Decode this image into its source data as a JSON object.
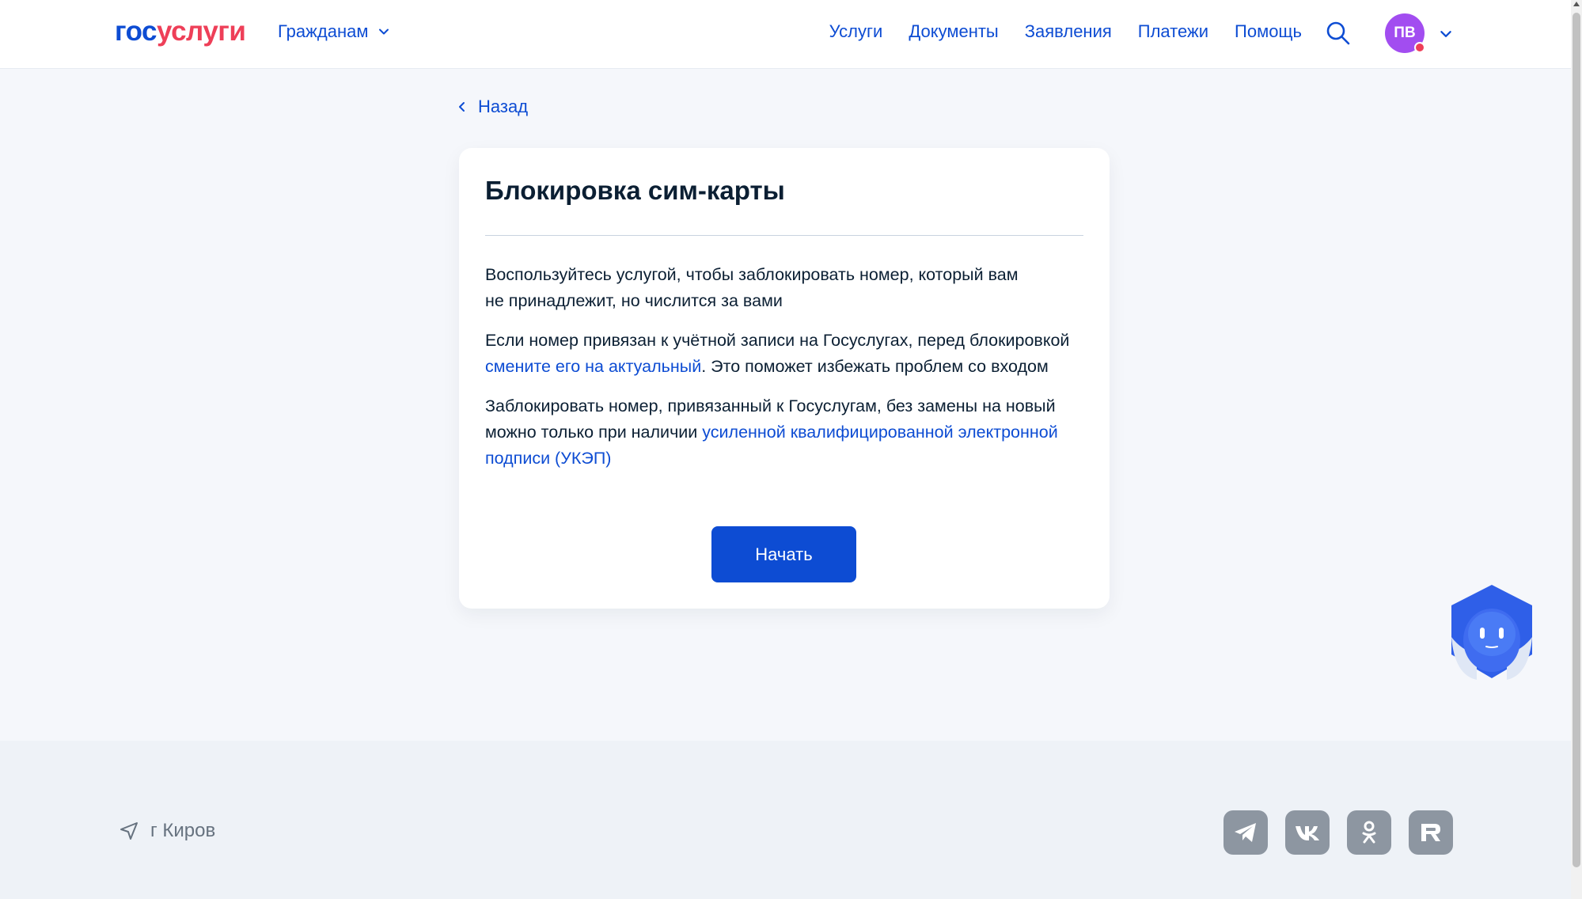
{
  "header": {
    "logo_part1": "гос",
    "logo_part2": "услуги",
    "audience_label": "Гражданам",
    "nav": [
      "Услуги",
      "Документы",
      "Заявления",
      "Платежи",
      "Помощь"
    ],
    "avatar_initials": "ПВ"
  },
  "back_label": "Назад",
  "card": {
    "title": "Блокировка сим-карты",
    "p1_line1": "Воспользуйтесь услугой, чтобы заблокировать номер, который вам",
    "p1_line2": "не принадлежит, но числится за вами",
    "p2_before": "Если номер привязан к учётной записи на Госуслугах, перед блокировкой ",
    "p2_link": "смените его на актуальный",
    "p2_after": ". Это поможет избежать проблем со входом",
    "p3_before": "Заблокировать номер, привязанный к Госуслугам, без замены на новый можно только при наличии ",
    "p3_link": "усиленной квалифицированной электронной подписи (УКЭП)",
    "start_button": "Начать"
  },
  "footer": {
    "city": "г Киров",
    "socials": [
      "telegram-icon",
      "vk-icon",
      "ok-icon",
      "rutube-icon"
    ]
  },
  "colors": {
    "accent": "#0d4cd3",
    "logo_red": "#ee3f58",
    "avatar": "#a24df0"
  }
}
